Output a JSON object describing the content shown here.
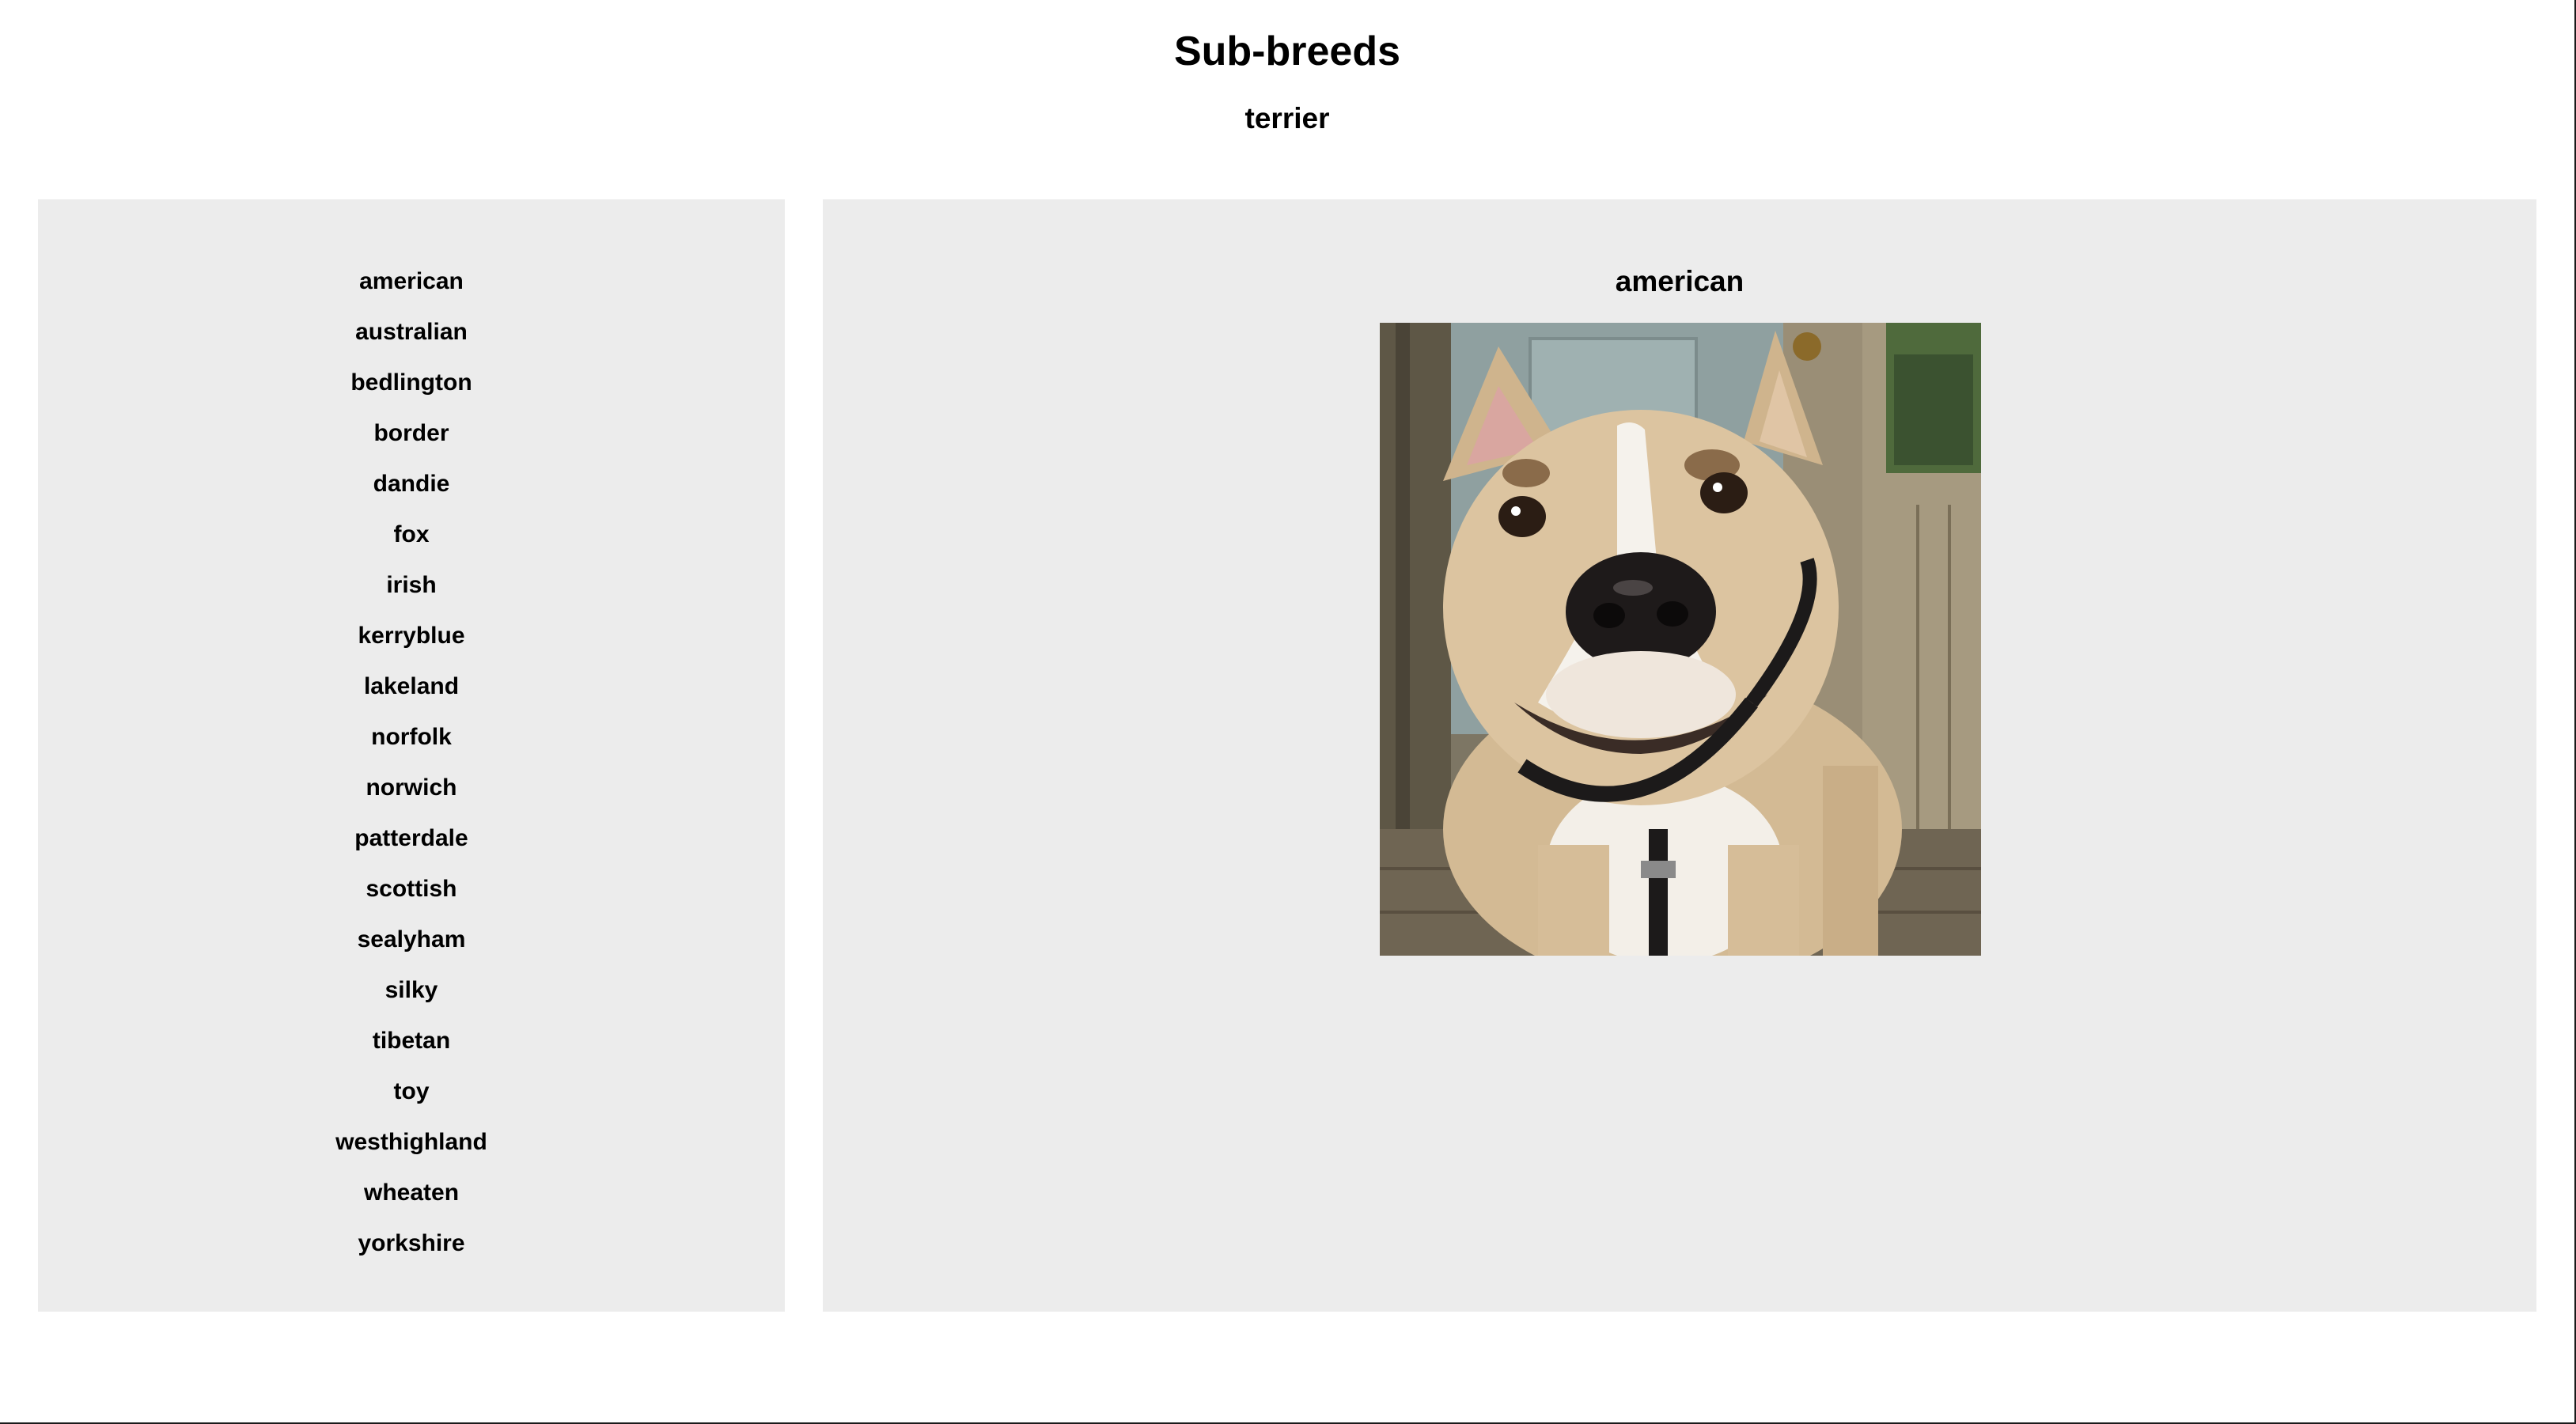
{
  "header": {
    "title": "Sub-breeds",
    "breed": "terrier"
  },
  "sidebar": {
    "items": [
      "american",
      "australian",
      "bedlington",
      "border",
      "dandie",
      "fox",
      "irish",
      "kerryblue",
      "lakeland",
      "norfolk",
      "norwich",
      "patterdale",
      "scottish",
      "sealyham",
      "silky",
      "tibetan",
      "toy",
      "westhighland",
      "wheaten",
      "yorkshire"
    ]
  },
  "main": {
    "selected_title": "american",
    "photo_icon": "dog-photo"
  },
  "colors": {
    "panel_background": "#ececec",
    "page_background": "#ffffff",
    "text": "#000000"
  }
}
